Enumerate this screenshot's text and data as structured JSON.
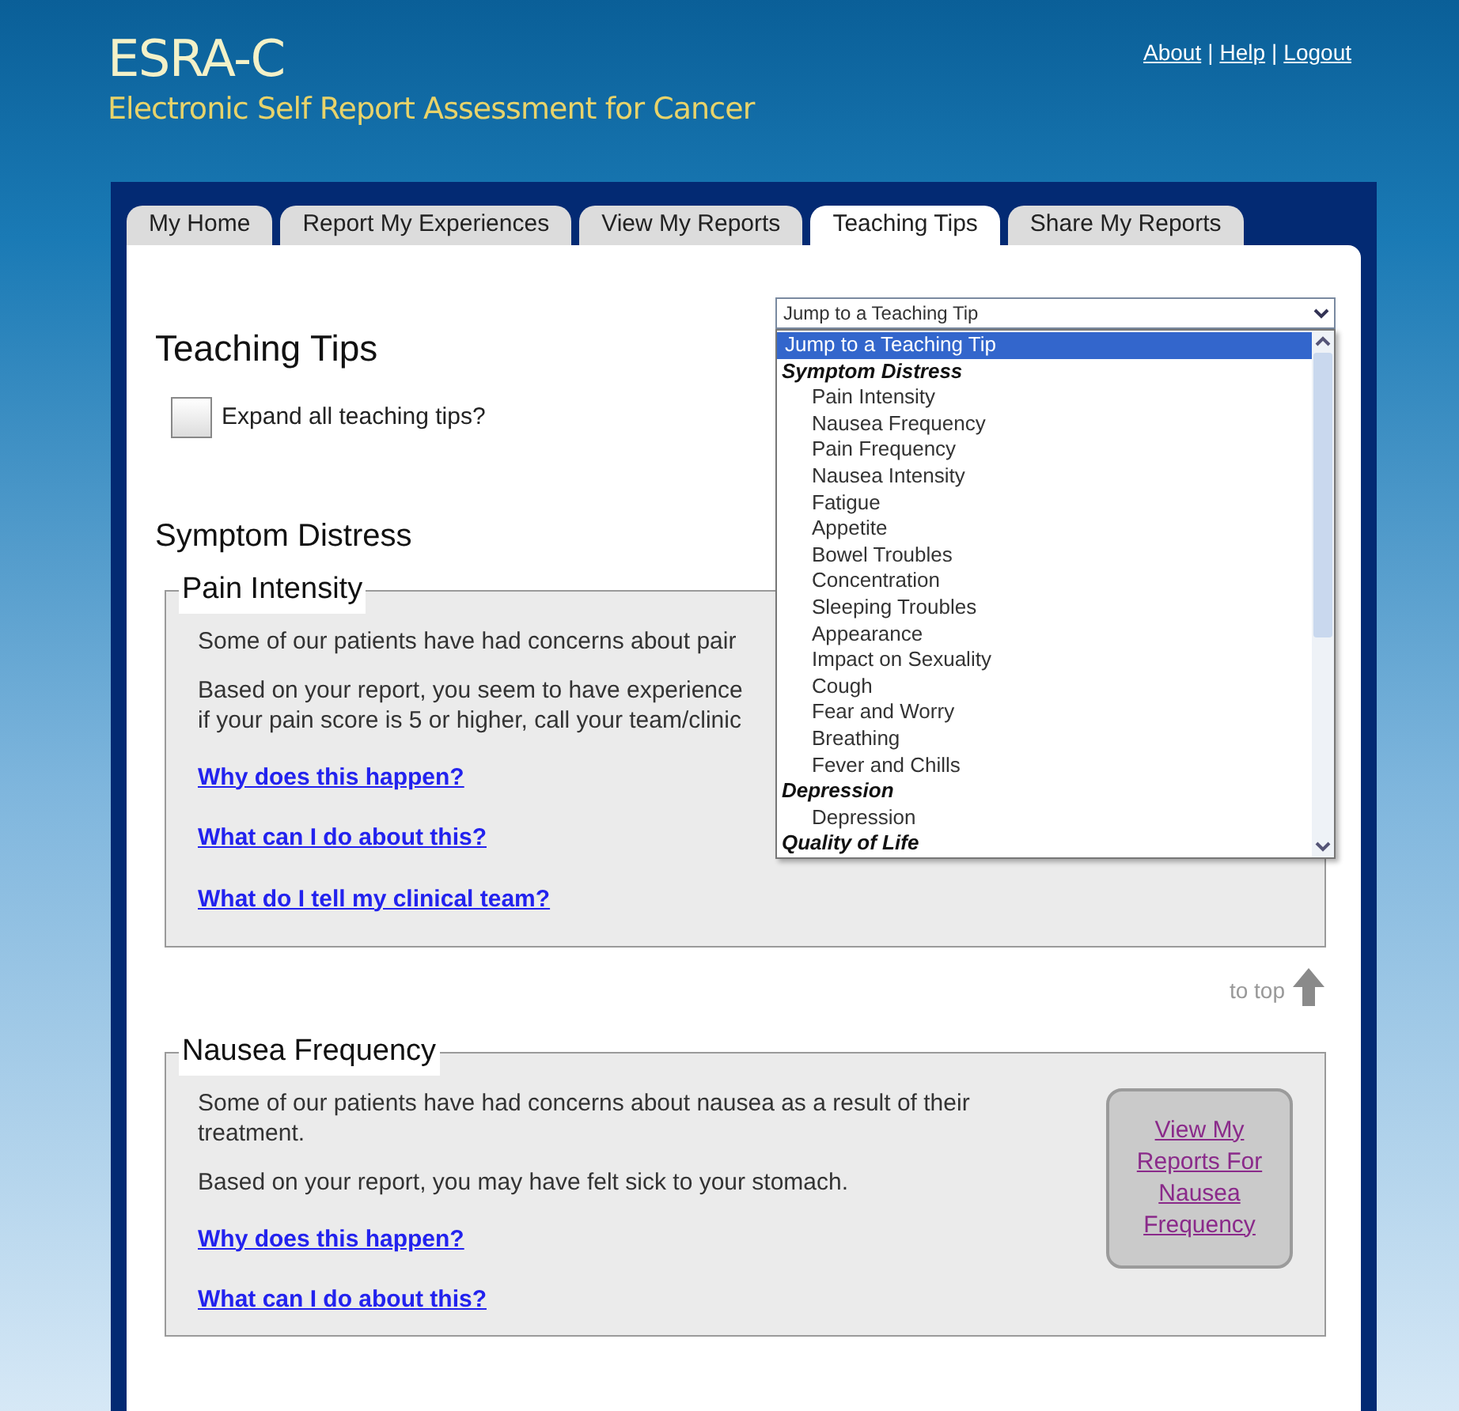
{
  "header": {
    "logo": "ESRA-C",
    "subtitle": "Electronic Self Report Assessment for Cancer",
    "links": [
      {
        "label": "About"
      },
      {
        "label": "Help"
      },
      {
        "label": "Logout"
      }
    ],
    "separator": "|"
  },
  "tabs": [
    {
      "label": "My Home",
      "selected": false
    },
    {
      "label": "Report My Experiences",
      "selected": false
    },
    {
      "label": "View My Reports",
      "selected": false
    },
    {
      "label": "Teaching Tips",
      "selected": true
    },
    {
      "label": "Share My Reports",
      "selected": false
    }
  ],
  "page_title": "Teaching Tips",
  "expand_all": {
    "label": "Expand all teaching tips?",
    "checked": false
  },
  "jump_select": {
    "value": "Jump to a Teaching Tip",
    "options": [
      {
        "kind": "option",
        "label": "Jump to a Teaching Tip",
        "selected": true
      },
      {
        "kind": "group",
        "label": "Symptom Distress"
      },
      {
        "kind": "option",
        "label": "Pain Intensity",
        "selected": false
      },
      {
        "kind": "option",
        "label": "Nausea Frequency",
        "selected": false
      },
      {
        "kind": "option",
        "label": "Pain Frequency",
        "selected": false
      },
      {
        "kind": "option",
        "label": "Nausea Intensity",
        "selected": false
      },
      {
        "kind": "option",
        "label": "Fatigue",
        "selected": false
      },
      {
        "kind": "option",
        "label": "Appetite",
        "selected": false
      },
      {
        "kind": "option",
        "label": "Bowel Troubles",
        "selected": false
      },
      {
        "kind": "option",
        "label": "Concentration",
        "selected": false
      },
      {
        "kind": "option",
        "label": "Sleeping Troubles",
        "selected": false
      },
      {
        "kind": "option",
        "label": "Appearance",
        "selected": false
      },
      {
        "kind": "option",
        "label": "Impact on Sexuality",
        "selected": false
      },
      {
        "kind": "option",
        "label": "Cough",
        "selected": false
      },
      {
        "kind": "option",
        "label": "Fear and Worry",
        "selected": false
      },
      {
        "kind": "option",
        "label": "Breathing",
        "selected": false
      },
      {
        "kind": "option",
        "label": "Fever and Chills",
        "selected": false
      },
      {
        "kind": "group",
        "label": "Depression"
      },
      {
        "kind": "option",
        "label": "Depression",
        "selected": false
      },
      {
        "kind": "group",
        "label": "Quality of Life"
      }
    ]
  },
  "section_title": "Symptom Distress",
  "tips": [
    {
      "title": "Pain Intensity",
      "paragraphs": [
        [
          "Some of our patients have had concerns about pair"
        ],
        [
          "Based on your report, you seem to have experience",
          "if your pain score is 5 or higher, call your team/clinic"
        ]
      ],
      "links": [
        "Why does this happen?",
        "What can I do about this?",
        "What do I tell my clinical team?"
      ],
      "to_top": "to top"
    },
    {
      "title": "Nausea Frequency",
      "paragraphs": [
        [
          "Some of our patients have had concerns about nausea as a result of their treatment."
        ],
        [
          "Based on your report, you may have felt sick to your stomach."
        ]
      ],
      "links": [
        "Why does this happen?",
        "What can I do about this?"
      ],
      "report_button": "View My Reports For Nausea Frequency"
    }
  ]
}
